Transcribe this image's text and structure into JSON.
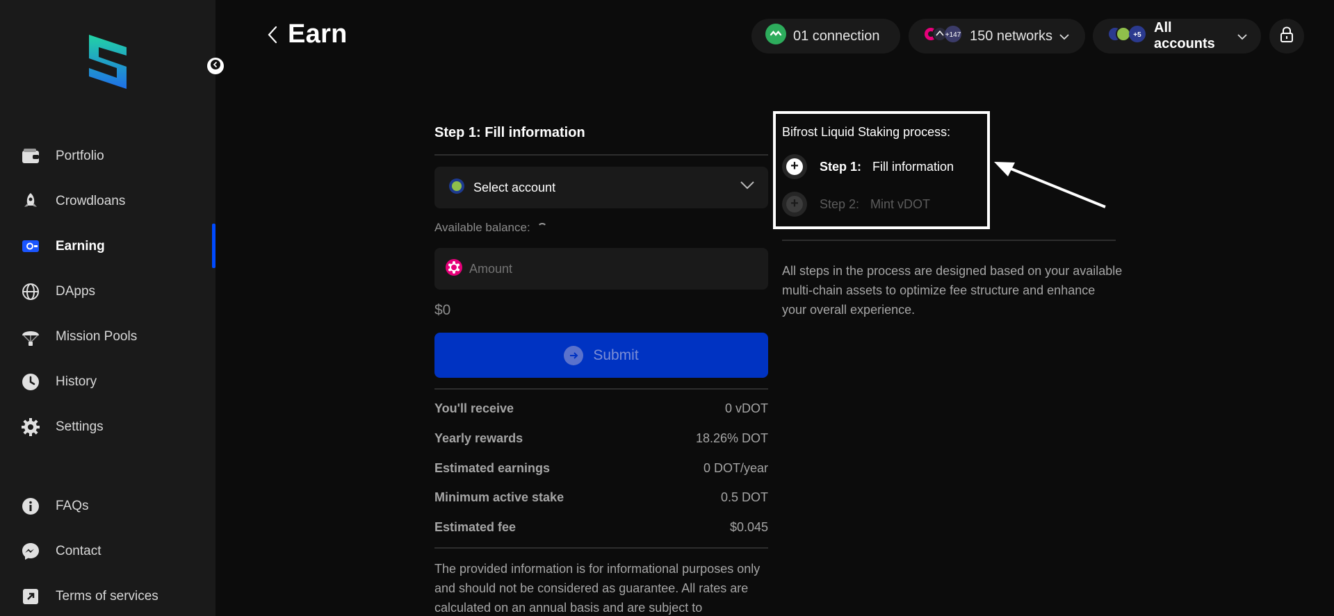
{
  "sidebar": {
    "items": [
      {
        "label": "Portfolio",
        "icon": "wallet-icon"
      },
      {
        "label": "Crowdloans",
        "icon": "rocket-icon"
      },
      {
        "label": "Earning",
        "icon": "earning-icon"
      },
      {
        "label": "DApps",
        "icon": "globe-icon"
      },
      {
        "label": "Mission Pools",
        "icon": "parachute-icon"
      },
      {
        "label": "History",
        "icon": "clock-icon"
      },
      {
        "label": "Settings",
        "icon": "gear-icon"
      },
      {
        "label": "FAQs",
        "icon": "info-icon"
      },
      {
        "label": "Contact",
        "icon": "messenger-icon"
      },
      {
        "label": "Terms of services",
        "icon": "external-link-icon"
      }
    ],
    "active": "Earning"
  },
  "header": {
    "title": "Earn",
    "connection_label": "01 connection",
    "networks_label": "150 networks",
    "networks_badge": "+147",
    "accounts_label": "All accounts",
    "accounts_badge": "+5"
  },
  "form": {
    "step_heading": "Step 1: Fill information",
    "select_account": "Select account",
    "available_balance": "Available balance:",
    "amount_placeholder": "Amount",
    "usd_value": "$0",
    "submit_label": "Submit",
    "details": [
      {
        "label": "You'll receive",
        "value": "0 vDOT"
      },
      {
        "label": "Yearly rewards",
        "value": "18.26% DOT"
      },
      {
        "label": "Estimated earnings",
        "value": "0 DOT/year"
      },
      {
        "label": "Minimum active stake",
        "value": "0.5 DOT"
      },
      {
        "label": "Estimated fee",
        "value": "$0.045"
      }
    ],
    "disclaimer": "The provided information is for informational purposes only and should not be considered as guarantee. All rates are calculated on an annual basis and are subject to"
  },
  "process": {
    "title": "Bifrost Liquid Staking process:",
    "steps": [
      {
        "num": "Step 1:",
        "name": "Fill information"
      },
      {
        "num": "Step 2:",
        "name": "Mint vDOT"
      }
    ],
    "description": "All steps in the process are designed based on your available multi-chain assets to optimize fee structure and enhance your overall experience."
  },
  "colors": {
    "accent": "#004bff",
    "submit_bg": "#0033c2",
    "connection_green": "#2dac5c",
    "polkadot_pink": "#e6007a"
  }
}
